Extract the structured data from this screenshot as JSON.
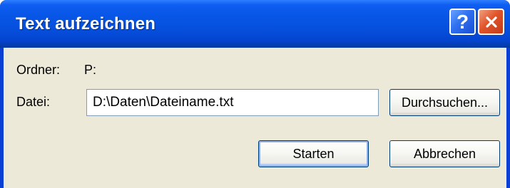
{
  "window": {
    "title": "Text aufzeichnen",
    "help_label": "?"
  },
  "folder": {
    "label": "Ordner:",
    "value": "P:"
  },
  "file": {
    "label": "Datei:",
    "value": "D:\\Daten\\Dateiname.txt"
  },
  "buttons": {
    "browse": "Durchsuchen...",
    "start": "Starten",
    "cancel": "Abbrechen"
  },
  "icons": {
    "help": "help-icon",
    "close": "close-icon"
  },
  "colors": {
    "titlebar": "#0650dd",
    "client_bg": "#ece9d8",
    "close_button": "#e0542b",
    "help_button": "#2f6ff0"
  }
}
